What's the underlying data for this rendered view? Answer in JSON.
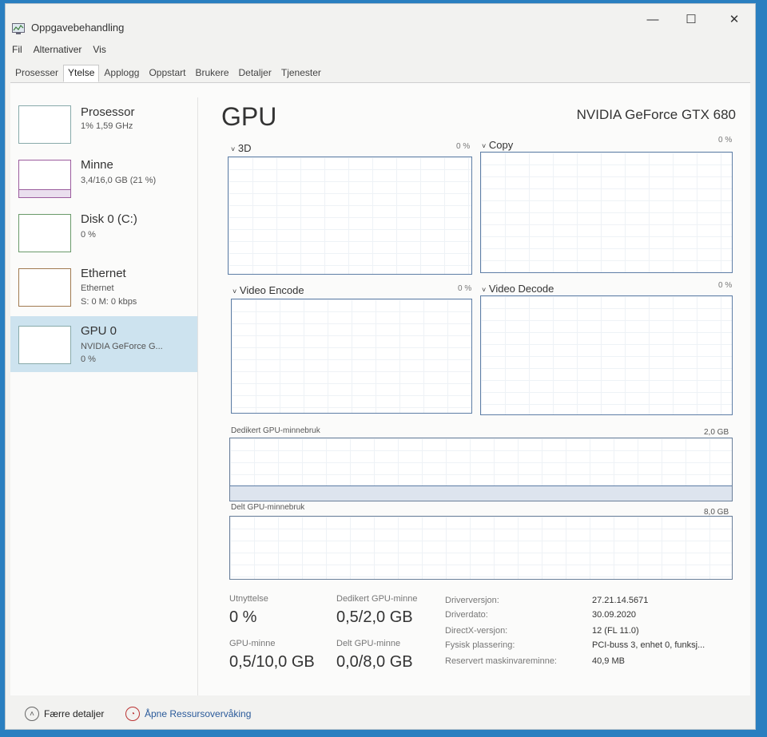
{
  "window": {
    "title": "Oppgavebehandling",
    "minimize": "—",
    "maximize": "☐",
    "close": "✕"
  },
  "menu": [
    "Fil",
    "Alternativer",
    "Vis"
  ],
  "tabs": [
    "Prosesser",
    "Ytelse",
    "Applogg",
    "Oppstart",
    "Brukere",
    "Detaljer",
    "Tjenester"
  ],
  "sidebar": {
    "items": [
      {
        "title": "Prosessor",
        "sub1": "1% 1,59 GHz",
        "sub2": ""
      },
      {
        "title": "Minne",
        "sub1": "3,4/16,0 GB (21 %)",
        "sub2": ""
      },
      {
        "title": "Disk 0 (C:)",
        "sub1": "0 %",
        "sub2": ""
      },
      {
        "title": "Ethernet",
        "sub1": "Ethernet",
        "sub2": "S: 0 M: 0 kbps"
      },
      {
        "title": "GPU 0",
        "sub1": "NVIDIA GeForce G...",
        "sub2": "0 %"
      }
    ]
  },
  "main": {
    "title": "GPU",
    "gpu_name": "NVIDIA GeForce GTX 680",
    "engines": [
      {
        "label": "3D",
        "pct": "0 %"
      },
      {
        "label": "Copy",
        "pct": "0 %"
      },
      {
        "label": "Video Encode",
        "pct": "0 %"
      },
      {
        "label": "Video Decode",
        "pct": "0 %"
      }
    ],
    "dedicated_mem": {
      "label": "Dedikert GPU-minnebruk",
      "max": "2,0 GB"
    },
    "shared_mem": {
      "label": "Delt GPU-minnebruk",
      "max": "8,0 GB"
    },
    "stats": {
      "util_label": "Utnyttelse",
      "util_value": "0 %",
      "ded_label": "Dedikert GPU-minne",
      "ded_value": "0,5/2,0 GB",
      "gpumem_label": "GPU-minne",
      "gpumem_value": "0,5/10,0 GB",
      "shared_label": "Delt GPU-minne",
      "shared_value": "0,0/8,0 GB"
    },
    "info": [
      {
        "label": "Driverversjon:",
        "value": "27.21.14.5671"
      },
      {
        "label": "Driverdato:",
        "value": "30.09.2020"
      },
      {
        "label": "DirectX-versjon:",
        "value": "12 (FL 11.0)"
      },
      {
        "label": "Fysisk plassering:",
        "value": "PCI-buss 3, enhet 0, funksj..."
      },
      {
        "label": "Reservert maskinvareminne:",
        "value": "40,9 MB"
      }
    ]
  },
  "footer": {
    "fewer_details": "Færre detaljer",
    "open_monitor": "Åpne Ressursovervåking"
  },
  "icons": {
    "expand": "chevron-down-icon",
    "fewer": "chevron-up-icon",
    "monitor": "resource-monitor-icon"
  },
  "colors": {
    "selected_bg": "#cde3ef",
    "graph_border": "#5e7ea6",
    "memory_line": "#9b5c9e"
  }
}
